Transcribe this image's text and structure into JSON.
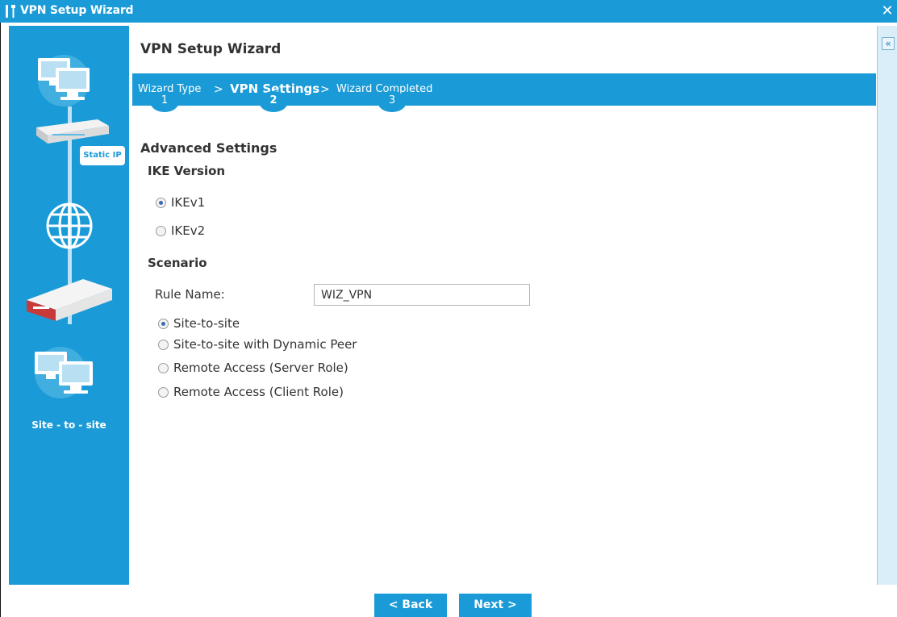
{
  "window": {
    "title": "VPN Setup Wizard",
    "close_glyph": "✕"
  },
  "page": {
    "heading": "VPN Setup Wizard",
    "collapse_glyph": "«"
  },
  "illustration": {
    "badge": "Static IP",
    "caption": "Site - to - site"
  },
  "steps": [
    {
      "label": "Wizard Type",
      "number": "1",
      "active": false
    },
    {
      "label": "VPN Settings",
      "number": "2",
      "active": true
    },
    {
      "label": "Wizard Completed",
      "number": "3",
      "active": false
    }
  ],
  "step_separator": ">",
  "advanced": {
    "title": "Advanced Settings",
    "ike": {
      "title": "IKE Version",
      "options": [
        {
          "label": "IKEv1",
          "checked": true
        },
        {
          "label": "IKEv2",
          "checked": false
        }
      ]
    },
    "scenario": {
      "title": "Scenario",
      "rule_name_label": "Rule Name:",
      "rule_name_value": "WIZ_VPN",
      "options": [
        {
          "label": "Site-to-site",
          "checked": true
        },
        {
          "label": "Site-to-site with Dynamic Peer",
          "checked": false
        },
        {
          "label": "Remote Access (Server Role)",
          "checked": false
        },
        {
          "label": "Remote Access (Client Role)",
          "checked": false
        }
      ]
    }
  },
  "footer": {
    "back_label": "< Back",
    "next_label": "Next >"
  },
  "colors": {
    "accent": "#1a9bd7",
    "strip": "#d9eef9"
  }
}
